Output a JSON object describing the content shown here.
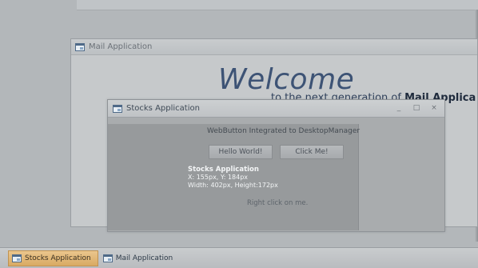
{
  "mail_window": {
    "title": "Mail Application",
    "welcome_heading": "Welcome",
    "welcome_sub_prefix": "to the next generation of ",
    "welcome_sub_brand": "Mail Applica"
  },
  "stocks_window": {
    "title": "Stocks Application",
    "controls": {
      "minimize": "_",
      "maximize": "□",
      "close": "×"
    },
    "panel": {
      "header": "WebButton Integrated to DesktopManager",
      "hello_button": "Hello World!",
      "click_button": "Click Me!",
      "info": {
        "title": "Stocks Application",
        "coords": "X: 155px, Y: 184px",
        "size": "Width: 402px, Height:172px"
      },
      "right_click_hint": "Right click on me."
    }
  },
  "taskbar": {
    "items": [
      {
        "label": "Stocks Application",
        "active": true
      },
      {
        "label": "Mail Application",
        "active": false
      }
    ]
  },
  "colors": {
    "desktop": "#b3b7ba",
    "active_task": "#d9aa63",
    "welcome_text": "#3d5375"
  },
  "icons": {
    "window": "window-icon"
  }
}
